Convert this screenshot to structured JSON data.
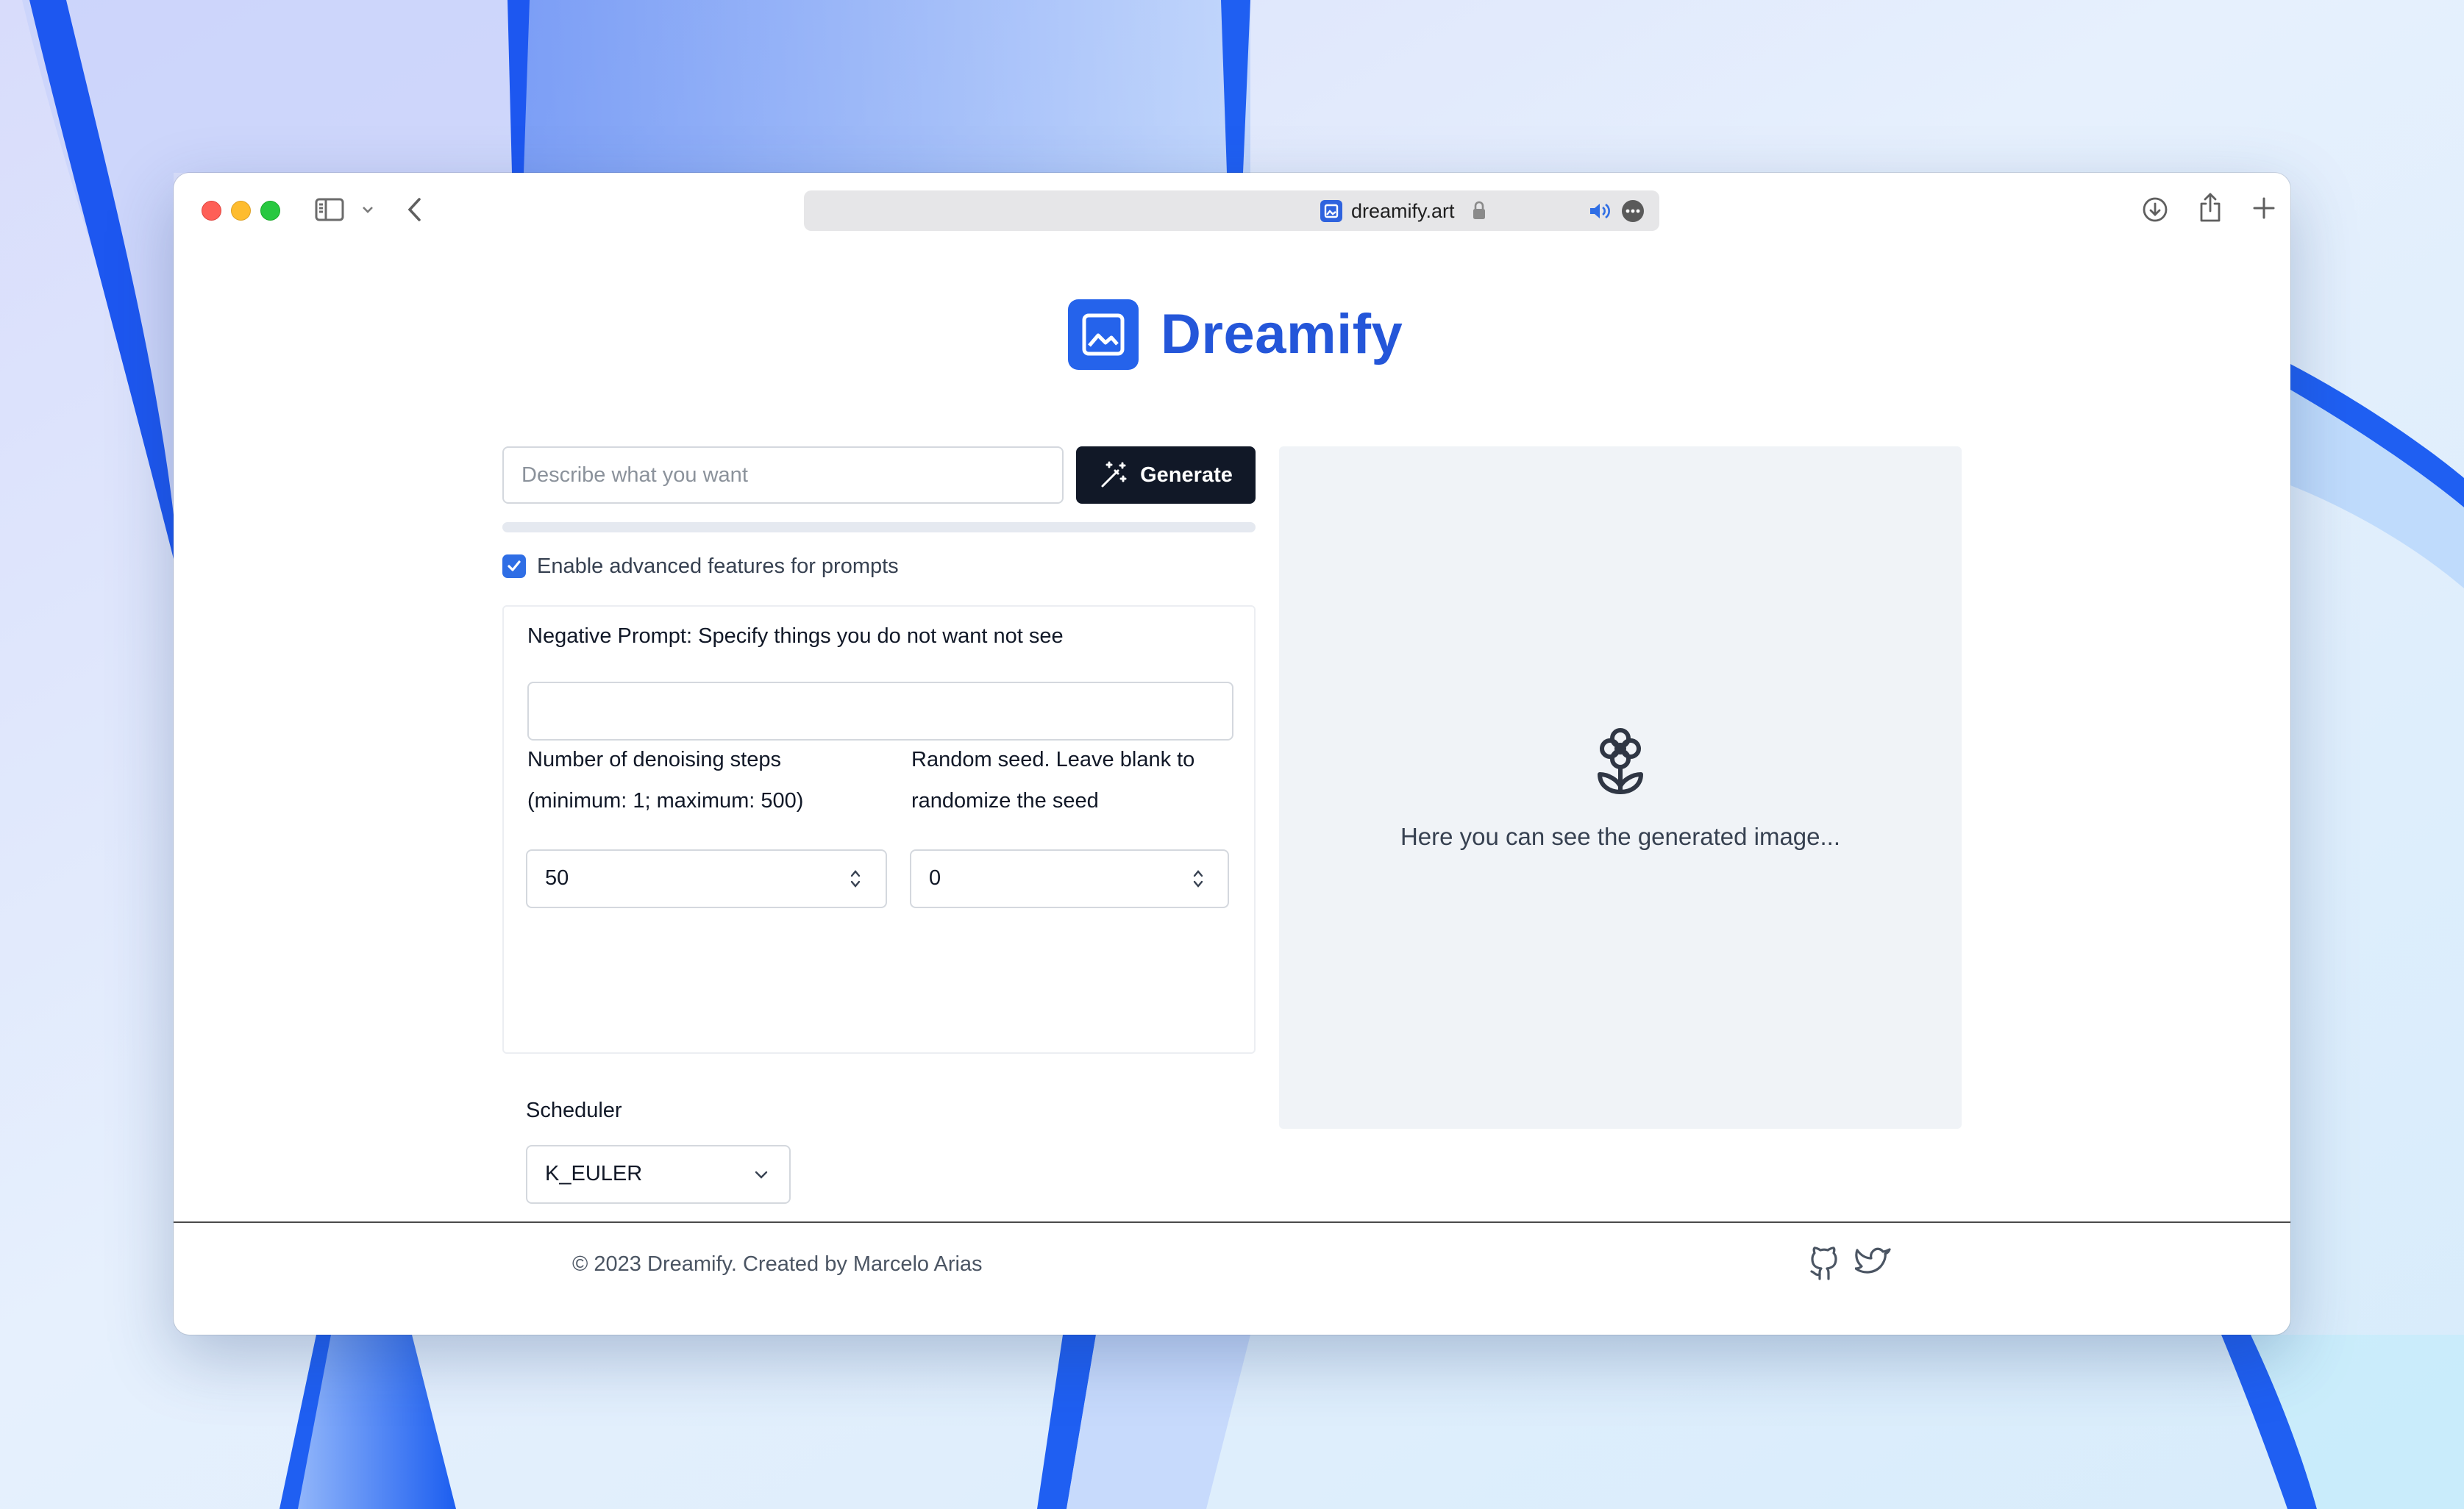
{
  "browser": {
    "url": "dreamify.art",
    "icons": {
      "sidebar": "sidebar-icon",
      "sidebar_dropdown": "chevron-down-icon",
      "back": "chevron-left-icon",
      "lock": "lock-icon",
      "audio": "speaker-icon",
      "more": "ellipsis-icon",
      "download": "download-icon",
      "share": "share-icon",
      "new_tab": "plus-icon"
    },
    "colors": {
      "close": "#fe5f57",
      "minimize": "#febc2e",
      "zoom": "#28c840"
    }
  },
  "brand": {
    "name": "Dreamify",
    "icon": "image-icon",
    "color": "#2563eb"
  },
  "prompt": {
    "placeholder": "Describe what you want",
    "value": ""
  },
  "generate_button": {
    "label": "Generate",
    "icon": "magic-wand-icon"
  },
  "progress": {
    "value": 0
  },
  "advanced": {
    "enabled": true,
    "label": "Enable advanced features for prompts",
    "negative_prompt": {
      "label": "Negative Prompt: Specify things you do not want not see",
      "value": ""
    },
    "steps": {
      "label_line1": "Number of denoising steps",
      "label_line2": "(minimum: 1; maximum: 500)",
      "value": "50"
    },
    "seed": {
      "label_line1": "Random seed. Leave blank to",
      "label_line2": "randomize the seed",
      "value": "0"
    },
    "scheduler": {
      "label": "Scheduler",
      "value": "K_EULER"
    }
  },
  "preview": {
    "icon": "flower-icon",
    "text": "Here you can see the generated image..."
  },
  "footer": {
    "copyright": "© 2023 Dreamify. Created by Marcelo Arias",
    "icons": [
      "github-icon",
      "twitter-icon"
    ]
  }
}
